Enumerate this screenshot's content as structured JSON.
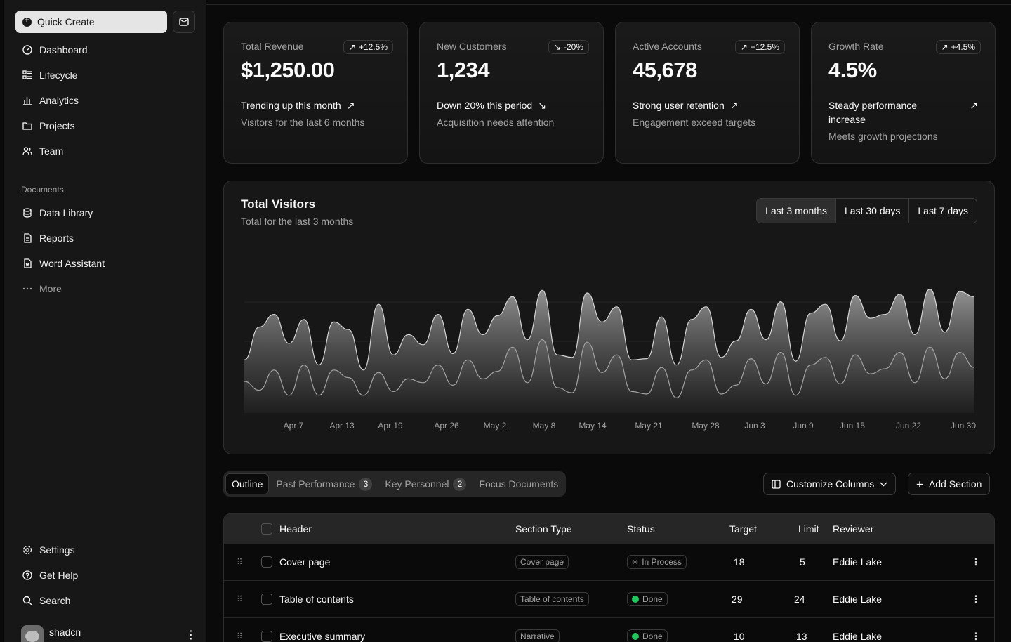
{
  "sidebar": {
    "quick_create": "Quick Create",
    "nav": [
      {
        "label": "Dashboard",
        "icon": "dashboard-icon"
      },
      {
        "label": "Lifecycle",
        "icon": "list-icon"
      },
      {
        "label": "Analytics",
        "icon": "chart-bar-icon"
      },
      {
        "label": "Projects",
        "icon": "folder-icon"
      },
      {
        "label": "Team",
        "icon": "users-icon"
      }
    ],
    "documents_label": "Documents",
    "documents": [
      {
        "label": "Data Library",
        "icon": "database-icon"
      },
      {
        "label": "Reports",
        "icon": "report-icon"
      },
      {
        "label": "Word Assistant",
        "icon": "file-word-icon"
      },
      {
        "label": "More",
        "icon": "dots-icon"
      }
    ],
    "secondary": [
      {
        "label": "Settings",
        "icon": "gear-icon"
      },
      {
        "label": "Get Help",
        "icon": "help-icon"
      },
      {
        "label": "Search",
        "icon": "search-icon"
      }
    ],
    "user": {
      "name": "shadcn"
    }
  },
  "cards": [
    {
      "label": "Total Revenue",
      "value": "$1,250.00",
      "badge": "+12.5%",
      "trend": "Trending up this month",
      "sub": "Visitors for the last 6 months",
      "direction": "up"
    },
    {
      "label": "New Customers",
      "value": "1,234",
      "badge": "-20%",
      "trend": "Down 20% this period",
      "sub": "Acquisition needs attention",
      "direction": "down"
    },
    {
      "label": "Active Accounts",
      "value": "45,678",
      "badge": "+12.5%",
      "trend": "Strong user retention",
      "sub": "Engagement exceed targets",
      "direction": "up"
    },
    {
      "label": "Growth Rate",
      "value": "4.5%",
      "badge": "+4.5%",
      "trend": "Steady performance increase",
      "sub": "Meets growth projections",
      "direction": "up"
    }
  ],
  "visitors": {
    "title": "Total Visitors",
    "subtitle": "Total for the last 3 months",
    "ranges": [
      "Last 3 months",
      "Last 30 days",
      "Last 7 days"
    ],
    "selected_range": "Last 3 months"
  },
  "chart_data": {
    "type": "area",
    "x_ticks": [
      "Apr 7",
      "Apr 13",
      "Apr 19",
      "Apr 26",
      "May 2",
      "May 8",
      "May 14",
      "May 21",
      "May 28",
      "Jun 3",
      "Jun 9",
      "Jun 15",
      "Jun 22",
      "Jun 30"
    ],
    "series": [
      {
        "values": [
          0.42,
          0.68,
          0.78,
          0.55,
          0.74,
          0.38,
          0.72,
          0.66,
          0.34,
          0.86,
          0.46,
          0.62,
          0.54,
          0.78,
          0.47,
          0.82,
          0.62,
          0.77,
          0.92,
          0.58,
          0.97,
          0.46,
          0.44,
          0.95,
          0.72,
          0.84,
          0.42,
          0.43,
          0.76,
          0.38,
          0.74,
          0.84,
          0.44,
          0.57,
          0.82,
          0.58,
          0.88,
          0.41,
          0.79,
          0.86,
          0.57,
          0.93,
          0.75,
          0.78,
          0.94,
          0.62,
          0.98,
          0.64,
          0.96,
          0.92
        ]
      },
      {
        "values": [
          0.25,
          0.18,
          0.34,
          0.14,
          0.38,
          0.14,
          0.34,
          0.28,
          0.14,
          0.32,
          0.17,
          0.27,
          0.24,
          0.38,
          0.22,
          0.42,
          0.27,
          0.33,
          0.52,
          0.24,
          0.58,
          0.2,
          0.16,
          0.56,
          0.32,
          0.46,
          0.17,
          0.15,
          0.36,
          0.12,
          0.34,
          0.42,
          0.15,
          0.22,
          0.43,
          0.23,
          0.48,
          0.14,
          0.38,
          0.44,
          0.23,
          0.46,
          0.31,
          0.35,
          0.48,
          0.24,
          0.52,
          0.27,
          0.48,
          0.36
        ]
      }
    ]
  },
  "tabs": [
    {
      "label": "Outline",
      "count": ""
    },
    {
      "label": "Past Performance",
      "count": "3"
    },
    {
      "label": "Key Personnel",
      "count": "2"
    },
    {
      "label": "Focus Documents",
      "count": ""
    }
  ],
  "actions": {
    "customize": "Customize Columns",
    "add_section": "Add Section"
  },
  "table": {
    "headers": [
      "Header",
      "Section Type",
      "Status",
      "Target",
      "Limit",
      "Reviewer"
    ],
    "rows": [
      {
        "header": "Cover page",
        "type": "Cover page",
        "status": "In Process",
        "target": "18",
        "limit": "5",
        "reviewer": "Eddie Lake"
      },
      {
        "header": "Table of contents",
        "type": "Table of contents",
        "status": "Done",
        "target": "29",
        "limit": "24",
        "reviewer": "Eddie Lake"
      },
      {
        "header": "Executive summary",
        "type": "Narrative",
        "status": "Done",
        "target": "10",
        "limit": "13",
        "reviewer": "Eddie Lake"
      }
    ]
  }
}
